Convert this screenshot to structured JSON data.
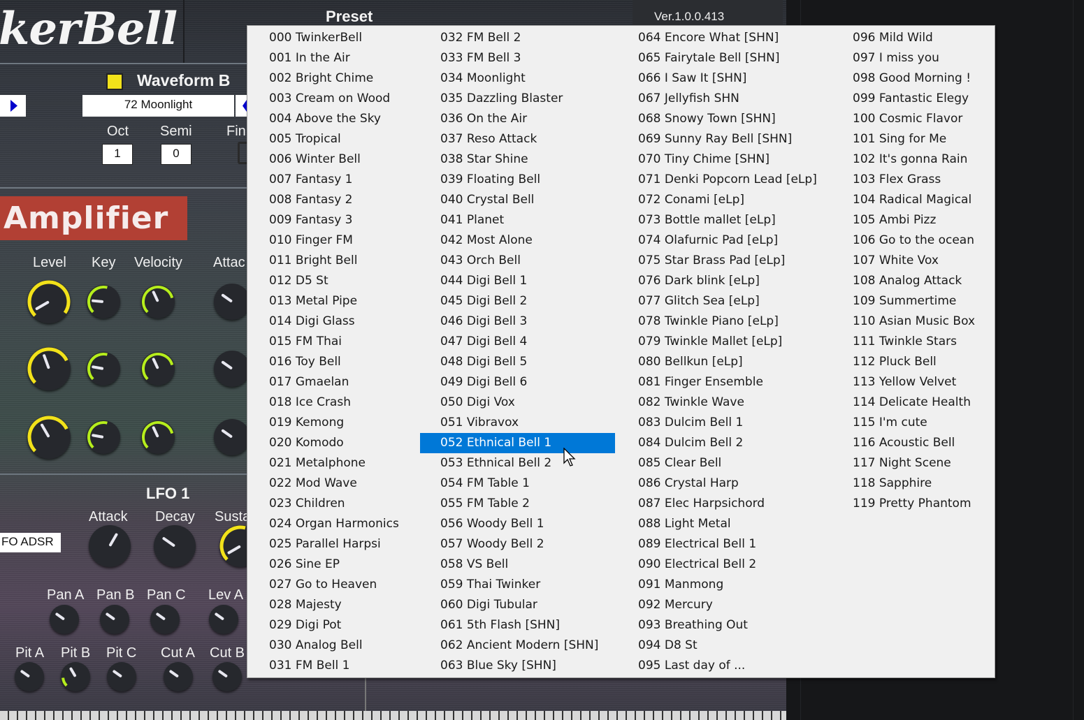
{
  "plugin": {
    "logo": "kerBell",
    "preset_label": "Preset",
    "version": "Ver.1.0.0.413",
    "waveform_b": {
      "label": "Waveform B",
      "value": "72 Moonlight"
    },
    "oct": {
      "label": "Oct",
      "value": "1"
    },
    "semi": {
      "label": "Semi",
      "value": "0"
    },
    "fine_label": "Fin",
    "amplifier_title": "Amplifier",
    "amp_labels": {
      "level": "Level",
      "key": "Key",
      "velocity": "Velocity",
      "attack": "Attac"
    },
    "lfo_title": "LFO 1",
    "lfo_labels": {
      "attack": "Attack",
      "decay": "Decay",
      "sustain": "Susta"
    },
    "lfo_adsr": "FO ADSR",
    "mod_row1": [
      "Pan A",
      "Pan B",
      "Pan C",
      "Lev A"
    ],
    "mod_row2": [
      "Pit A",
      "Pit B",
      "Pit C",
      "Cut A",
      "Cut B"
    ],
    "colors": {
      "accent_yellow": "#f2e21a",
      "accent_green": "#b6ee1c",
      "amp_red": "#b24034",
      "selection_blue": "#0078d7"
    }
  },
  "preset_menu": {
    "selected_index": 52,
    "columns": [
      [
        "000 TwinkerBell",
        "001 In the Air",
        "002 Bright Chime",
        "003 Cream on Wood",
        "004 Above the Sky",
        "005 Tropical",
        "006 Winter Bell",
        "007 Fantasy 1",
        "008 Fantasy 2",
        "009 Fantasy 3",
        "010 Finger FM",
        "011 Bright Bell",
        "012 D5 St",
        "013 Metal Pipe",
        "014 Digi Glass",
        "015 FM Thai",
        "016 Toy Bell",
        "017 Gmaelan",
        "018 Ice Crash",
        "019 Kemong",
        "020 Komodo",
        "021 Metalphone",
        "022 Mod Wave",
        "023 Children",
        "024 Organ Harmonics",
        "025 Parallel Harpsi",
        "026 Sine EP",
        "027 Go to Heaven",
        "028 Majesty",
        "029 Digi Pot",
        "030 Analog Bell",
        "031 FM Bell 1"
      ],
      [
        "032 FM Bell 2",
        "033 FM Bell 3",
        "034 Moonlight",
        "035 Dazzling Blaster",
        "036 On the Air",
        "037 Reso Attack",
        "038 Star Shine",
        "039 Floating Bell",
        "040 Crystal Bell",
        "041 Planet",
        "042 Most Alone",
        "043 Orch Bell",
        "044 Digi Bell 1",
        "045 Digi Bell 2",
        "046 Digi Bell 3",
        "047 Digi Bell 4",
        "048 Digi Bell 5",
        "049 Digi Bell 6",
        "050 Digi Vox",
        "051 Vibravox",
        "052 Ethnical Bell 1",
        "053 Ethnical Bell 2",
        "054 FM Table 1",
        "055 FM Table 2",
        "056 Woody Bell 1",
        "057 Woody Bell 2",
        "058 VS Bell",
        "059 Thai Twinker",
        "060 Digi Tubular",
        "061 5th Flash [SHN]",
        "062 Ancient Modern [SHN]",
        "063 Blue Sky [SHN]"
      ],
      [
        "064 Encore What [SHN]",
        "065 Fairytale Bell [SHN]",
        "066 I Saw It [SHN]",
        "067 Jellyfish SHN",
        "068 Snowy Town [SHN]",
        "069 Sunny Ray Bell [SHN]",
        "070 Tiny Chime [SHN]",
        "071 Denki Popcorn Lead [eLp]",
        "072 Conami [eLp]",
        "073 Bottle mallet [eLp]",
        "074 Olafurnic Pad [eLp]",
        "075 Star Brass Pad [eLp]",
        "076 Dark blink [eLp]",
        "077 Glitch Sea [eLp]",
        "078 Twinkle Piano [eLp]",
        "079 Twinkle Mallet [eLp]",
        "080 Bellkun [eLp]",
        "081 Finger Ensemble",
        "082 Twinkle Wave",
        "083 Dulcim Bell 1",
        "084 Dulcim Bell 2",
        "085 Clear Bell",
        "086 Crystal Harp",
        "087 Elec Harpsichord",
        "088 Light Metal",
        "089 Electrical Bell 1",
        "090 Electrical Bell 2",
        "091 Manmong",
        "092 Mercury",
        "093 Breathing Out",
        "094 D8 St",
        "095 Last day of ..."
      ],
      [
        "096 Mild Wild",
        "097 I miss you",
        "098 Good Morning !",
        "099 Fantastic Elegy",
        "100 Cosmic Flavor",
        "101 Sing for Me",
        "102 It's gonna Rain",
        "103 Flex Grass",
        "104 Radical Magical",
        "105 Ambi Pizz",
        "106 Go to the ocean",
        "107 White Vox",
        "108 Analog Attack",
        "109 Summertime",
        "110 Asian Music Box",
        "111 Twinkle Stars",
        "112 Pluck Bell",
        "113 Yellow Velvet",
        "114 Delicate Health",
        "115 I'm cute",
        "116 Acoustic Bell",
        "117 Night Scene",
        "118 Sapphire",
        "119 Pretty Phantom"
      ]
    ]
  }
}
